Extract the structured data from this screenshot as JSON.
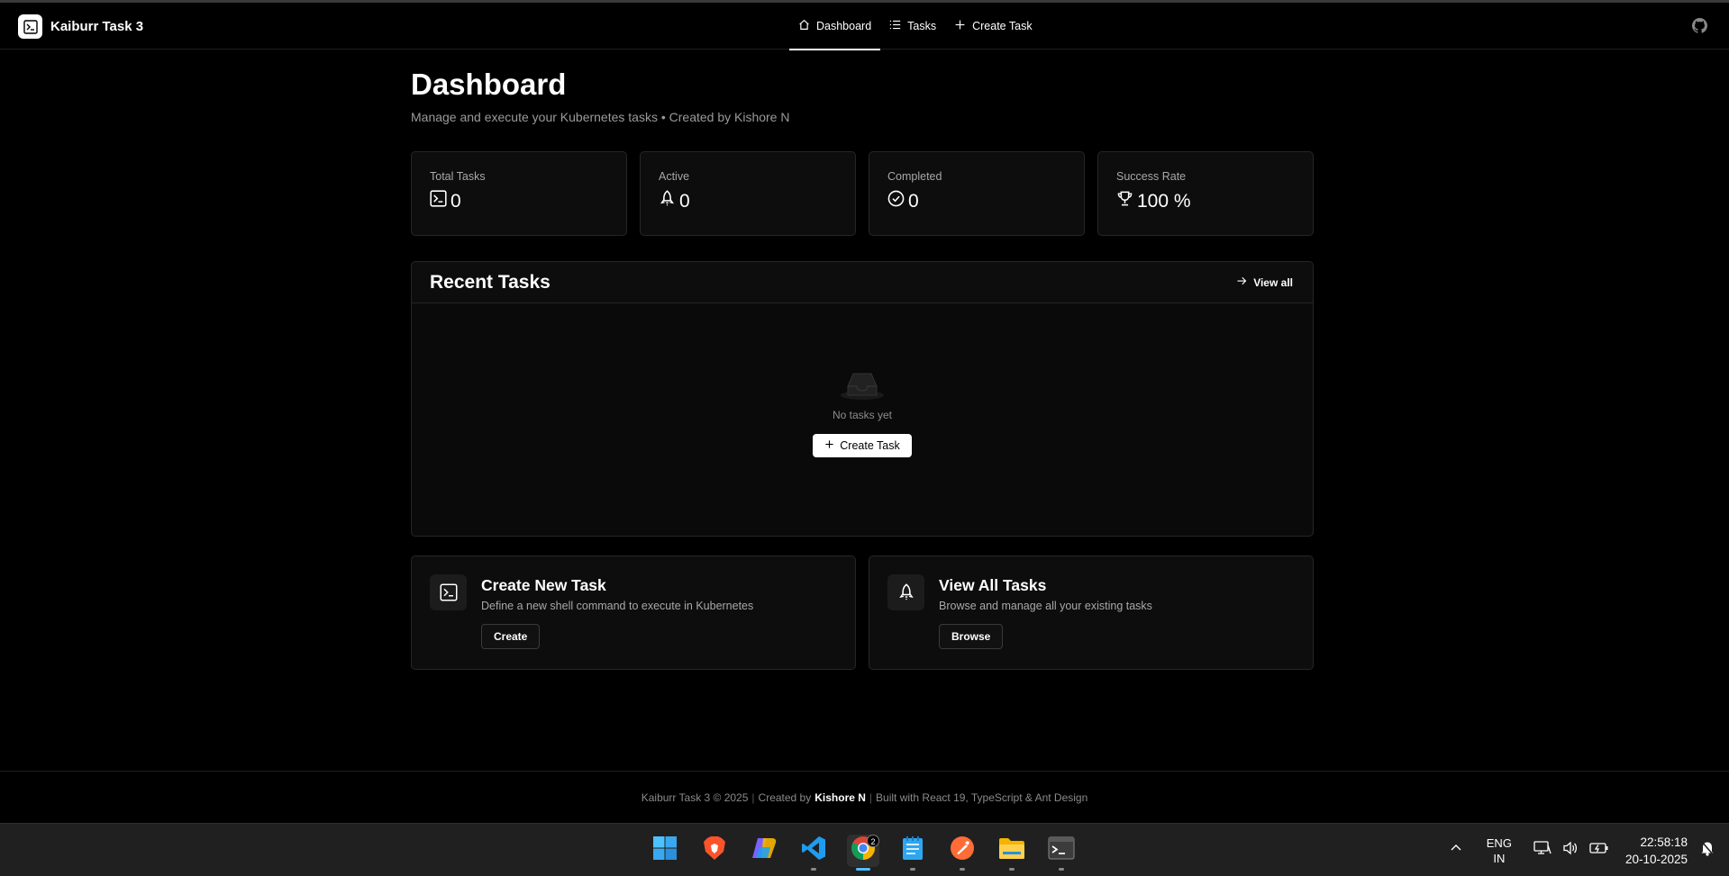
{
  "header": {
    "brand_title": "Kaiburr Task 3",
    "nav": [
      {
        "label": "Dashboard",
        "icon": "home-icon",
        "active": true
      },
      {
        "label": "Tasks",
        "icon": "list-icon",
        "active": false
      },
      {
        "label": "Create Task",
        "icon": "plus-icon",
        "active": false
      }
    ],
    "github_icon": "github-icon"
  },
  "page": {
    "title": "Dashboard",
    "subtitle": "Manage and execute your Kubernetes tasks • Created by Kishore N"
  },
  "stats": [
    {
      "label": "Total Tasks",
      "value": "0",
      "icon": "terminal-icon"
    },
    {
      "label": "Active",
      "value": "0",
      "icon": "rocket-icon"
    },
    {
      "label": "Completed",
      "value": "0",
      "icon": "check-circle-icon"
    },
    {
      "label": "Success Rate",
      "value": "100 %",
      "icon": "trophy-icon"
    }
  ],
  "recent": {
    "title": "Recent Tasks",
    "view_all": "View all",
    "empty_text": "No tasks yet",
    "empty_button": "Create Task"
  },
  "quick_actions": [
    {
      "title": "Create New Task",
      "description": "Define a new shell command to execute in Kubernetes",
      "button": "Create",
      "icon": "terminal-icon"
    },
    {
      "title": "View All Tasks",
      "description": "Browse and manage all your existing tasks",
      "button": "Browse",
      "icon": "rocket-icon"
    }
  ],
  "footer": {
    "part1": "Kaiburr Task 3 © 2025",
    "created_by": "Created by",
    "author": "Kishore N",
    "built_with": "Built with React 19, TypeScript & Ant Design",
    "separator": "|"
  },
  "taskbar": {
    "apps": [
      "windows-start-icon",
      "brave-browser-icon",
      "copilot-icon",
      "vscode-icon",
      "chrome-icon",
      "notepad-icon",
      "postman-icon",
      "file-explorer-icon",
      "terminal-app-icon"
    ],
    "chrome_badge": "2",
    "lang_line1": "ENG",
    "lang_line2": "IN",
    "time": "22:58:18",
    "date": "20-10-2025"
  },
  "colors": {
    "background": "#000000",
    "card": "#0d0d0d",
    "border": "#262626",
    "accent": "#4cc2ff"
  }
}
